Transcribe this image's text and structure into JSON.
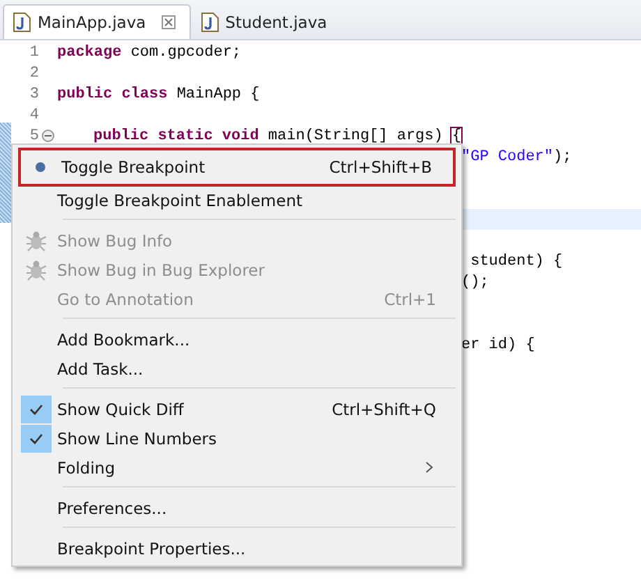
{
  "tabs": [
    {
      "label": "MainApp.java",
      "selected": true,
      "closable": true
    },
    {
      "label": "Student.java",
      "selected": false,
      "closable": false
    }
  ],
  "code_lines": [
    {
      "kind": "top",
      "number": "1",
      "tokens": [
        {
          "kind": "keyword",
          "text": "package"
        },
        {
          "kind": "plain",
          "text": " com.gpcoder;"
        }
      ]
    },
    {
      "kind": "top",
      "number": "2"
    },
    {
      "kind": "top",
      "number": "3",
      "tokens": [
        {
          "kind": "keyword",
          "text": "public class"
        },
        {
          "kind": "plain",
          "text": " MainApp {"
        }
      ]
    },
    {
      "kind": "top",
      "number": "4"
    },
    {
      "kind": "member",
      "number": "5",
      "folded": false,
      "tokens": [
        {
          "kind": "keyword",
          "text": "public static void"
        },
        {
          "kind": "plain",
          "text": " main(String[] args) "
        },
        {
          "kind": "bracket",
          "text": "{"
        }
      ]
    },
    {
      "kind": "partial",
      "tokens": [
        {
          "kind": "string",
          "text": "\"GP Coder\""
        },
        {
          "kind": "plain",
          "text": ");"
        }
      ]
    },
    {
      "kind": "partial"
    },
    {
      "kind": "partial"
    },
    {
      "kind": "partial",
      "current": true
    },
    {
      "kind": "partial"
    },
    {
      "kind": "partial",
      "tokens": [
        {
          "kind": "plain",
          "text": " student) {"
        }
      ]
    },
    {
      "kind": "partial",
      "tokens": [
        {
          "kind": "plain",
          "text": "();"
        }
      ]
    },
    {
      "kind": "partial"
    },
    {
      "kind": "partial"
    },
    {
      "kind": "partial",
      "tokens": [
        {
          "kind": "plain",
          "text": "er id) {"
        }
      ]
    }
  ],
  "context_menu": [
    {
      "kind": "breakpoint_item",
      "label": "Toggle Breakpoint",
      "shortcut": "Ctrl+Shift+B",
      "highlighted": true,
      "disabled": false,
      "checked": false
    },
    {
      "kind": "item",
      "label": "Toggle Breakpoint Enablement",
      "disabled": false,
      "checked": false
    },
    {
      "kind": "separator"
    },
    {
      "kind": "bug_item",
      "label": "Show Bug Info",
      "disabled": true,
      "checked": false
    },
    {
      "kind": "bug_item",
      "label": "Show Bug in Bug Explorer",
      "disabled": true,
      "checked": false
    },
    {
      "kind": "item",
      "label": "Go to Annotation",
      "shortcut": "Ctrl+1",
      "disabled": true,
      "checked": false
    },
    {
      "kind": "separator"
    },
    {
      "kind": "item",
      "label": "Add Bookmark...",
      "disabled": false,
      "checked": false
    },
    {
      "kind": "item",
      "label": "Add Task...",
      "disabled": false,
      "checked": false
    },
    {
      "kind": "separator"
    },
    {
      "kind": "item",
      "label": "Show Quick Diff",
      "shortcut": "Ctrl+Shift+Q",
      "disabled": false,
      "checked": true
    },
    {
      "kind": "item",
      "label": "Show Line Numbers",
      "disabled": false,
      "checked": true
    },
    {
      "kind": "submenu",
      "label": "Folding",
      "disabled": false,
      "checked": false
    },
    {
      "kind": "separator"
    },
    {
      "kind": "item",
      "label": "Preferences...",
      "disabled": false,
      "checked": false
    },
    {
      "kind": "separator"
    },
    {
      "kind": "item",
      "label": "Breakpoint Properties...",
      "disabled": false,
      "checked": false
    }
  ]
}
